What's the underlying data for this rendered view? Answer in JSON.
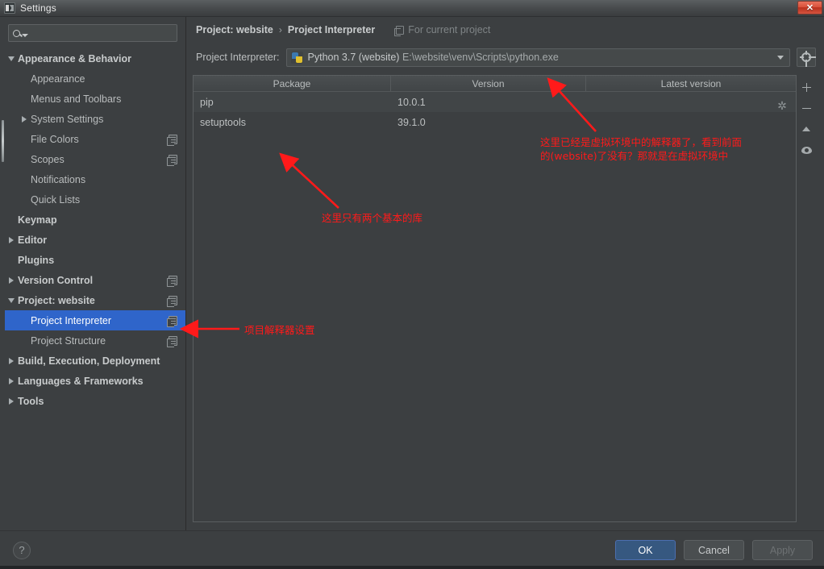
{
  "window": {
    "title": "Settings",
    "app_icon": "pycharm-icon",
    "close_label": "✕"
  },
  "search": {
    "value": "",
    "placeholder": "",
    "icon": "search-icon"
  },
  "sidebar": {
    "items": [
      {
        "label": "Appearance & Behavior",
        "indent": 0,
        "twisty": "down",
        "bold": true,
        "copy": false,
        "selected": false
      },
      {
        "label": "Appearance",
        "indent": 1,
        "twisty": "none",
        "bold": false,
        "copy": false,
        "selected": false
      },
      {
        "label": "Menus and Toolbars",
        "indent": 1,
        "twisty": "none",
        "bold": false,
        "copy": false,
        "selected": false
      },
      {
        "label": "System Settings",
        "indent": 1,
        "twisty": "right",
        "bold": false,
        "copy": false,
        "selected": false
      },
      {
        "label": "File Colors",
        "indent": 1,
        "twisty": "none",
        "bold": false,
        "copy": true,
        "selected": false
      },
      {
        "label": "Scopes",
        "indent": 1,
        "twisty": "none",
        "bold": false,
        "copy": true,
        "selected": false
      },
      {
        "label": "Notifications",
        "indent": 1,
        "twisty": "none",
        "bold": false,
        "copy": false,
        "selected": false
      },
      {
        "label": "Quick Lists",
        "indent": 1,
        "twisty": "none",
        "bold": false,
        "copy": false,
        "selected": false
      },
      {
        "label": "Keymap",
        "indent": 0,
        "twisty": "none",
        "bold": true,
        "copy": false,
        "selected": false
      },
      {
        "label": "Editor",
        "indent": 0,
        "twisty": "right",
        "bold": true,
        "copy": false,
        "selected": false
      },
      {
        "label": "Plugins",
        "indent": 0,
        "twisty": "none",
        "bold": true,
        "copy": false,
        "selected": false
      },
      {
        "label": "Version Control",
        "indent": 0,
        "twisty": "right",
        "bold": true,
        "copy": true,
        "selected": false
      },
      {
        "label": "Project: website",
        "indent": 0,
        "twisty": "down",
        "bold": true,
        "copy": true,
        "selected": false
      },
      {
        "label": "Project Interpreter",
        "indent": 1,
        "twisty": "none",
        "bold": false,
        "copy": true,
        "selected": true
      },
      {
        "label": "Project Structure",
        "indent": 1,
        "twisty": "none",
        "bold": false,
        "copy": true,
        "selected": false
      },
      {
        "label": "Build, Execution, Deployment",
        "indent": 0,
        "twisty": "right",
        "bold": true,
        "copy": false,
        "selected": false
      },
      {
        "label": "Languages & Frameworks",
        "indent": 0,
        "twisty": "right",
        "bold": true,
        "copy": false,
        "selected": false
      },
      {
        "label": "Tools",
        "indent": 0,
        "twisty": "right",
        "bold": true,
        "copy": false,
        "selected": false
      }
    ]
  },
  "main": {
    "breadcrumb": {
      "root": "Project: website",
      "separator": "›",
      "leaf": "Project Interpreter",
      "scope_note": "For current project",
      "scope_icon": "copy-icon"
    },
    "interpreter": {
      "label": "Project Interpreter:",
      "icon": "python-icon",
      "name": "Python 3.7 (website)",
      "path": "E:\\website\\venv\\Scripts\\python.exe",
      "dropdown_icon": "chevron-down-icon",
      "settings_icon": "gear-icon"
    },
    "table": {
      "columns": [
        "Package",
        "Version",
        "Latest version"
      ],
      "rows": [
        {
          "package": "pip",
          "version": "10.0.1",
          "latest": ""
        },
        {
          "package": "setuptools",
          "version": "39.1.0",
          "latest": ""
        }
      ],
      "loading_indicator": "spinner-icon"
    },
    "toolbar": [
      {
        "name": "add-package-button",
        "icon": "plus-icon"
      },
      {
        "name": "remove-package-button",
        "icon": "minus-icon"
      },
      {
        "name": "upgrade-package-button",
        "icon": "arrow-up-icon"
      },
      {
        "name": "show-early-releases-button",
        "icon": "eye-icon"
      }
    ]
  },
  "footer": {
    "help_label": "?",
    "ok_label": "OK",
    "cancel_label": "Cancel",
    "apply_label": "Apply"
  },
  "annotations": [
    {
      "id": "interpreter-note",
      "text": "这里已经是虚拟环境中的解释器了，看到前面\n的(website)了没有？那就是在虚拟环境中",
      "color": "#ff1a1a"
    },
    {
      "id": "packages-note",
      "text": "这里只有两个基本的库",
      "color": "#ff1a1a"
    },
    {
      "id": "sidebar-note",
      "text": "项目解释器设置",
      "color": "#ff1a1a"
    }
  ],
  "colors": {
    "window_bg": "#3c3f41",
    "selection": "#2f65ca",
    "primary_button": "#365880",
    "annotation": "#ff1a1a"
  }
}
